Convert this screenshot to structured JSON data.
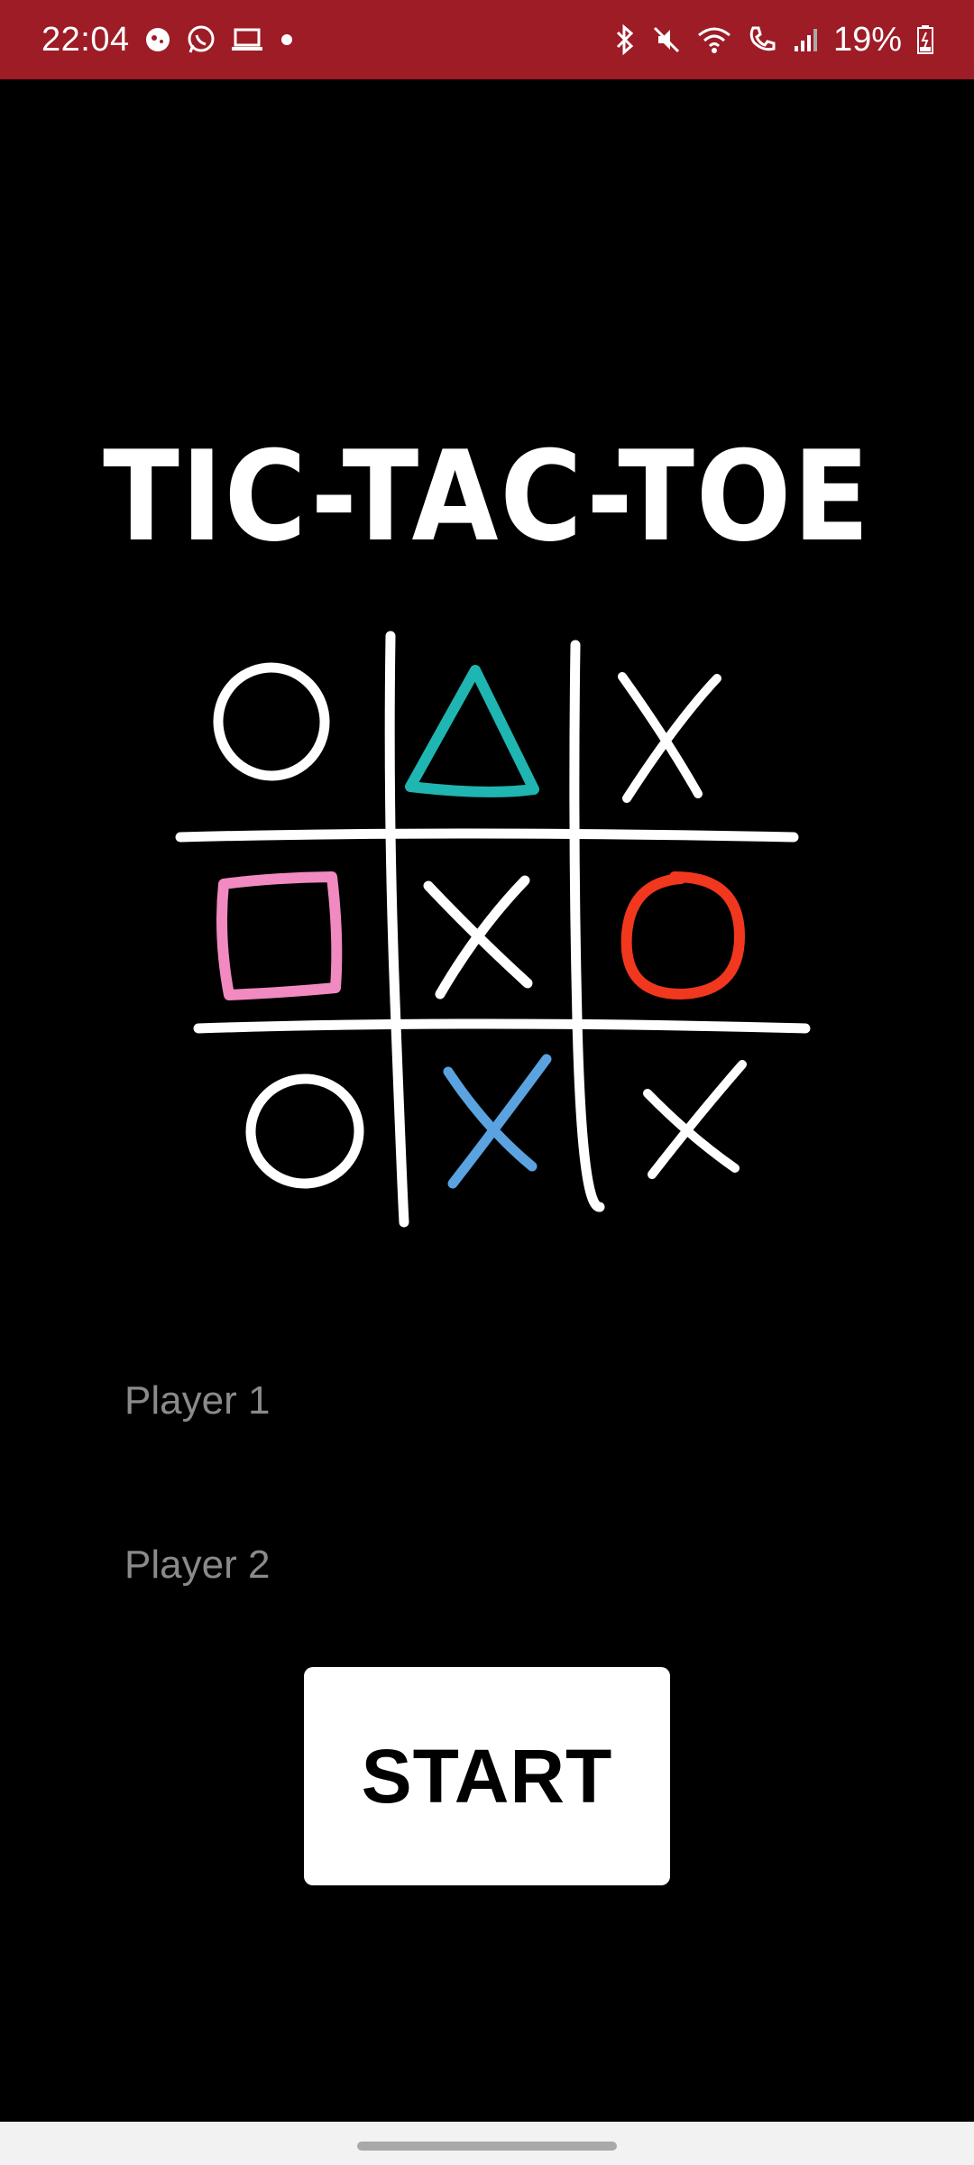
{
  "status_bar": {
    "time": "22:04",
    "battery": "19%",
    "background": "#9d1c26",
    "left_icons": [
      "game-icon",
      "whatsapp-icon",
      "laptop-icon",
      "dot-icon"
    ],
    "right_icons": [
      "bluetooth-icon",
      "mute-icon",
      "wifi-icon",
      "call-icon",
      "signal-icon",
      "battery-icon"
    ]
  },
  "title": "TIC-TAC-TOE",
  "board": {
    "cells": [
      "O",
      "triangle",
      "X",
      "square",
      "X",
      "O",
      "O",
      "X",
      "X"
    ],
    "colors": {
      "white": "#ffffff",
      "teal": "#1fb5b1",
      "pink": "#f08ac0",
      "red": "#f2371f",
      "blue": "#5aa3e0"
    }
  },
  "form": {
    "player1_placeholder": "Player 1",
    "player2_placeholder": "Player 2",
    "start_label": "START"
  }
}
